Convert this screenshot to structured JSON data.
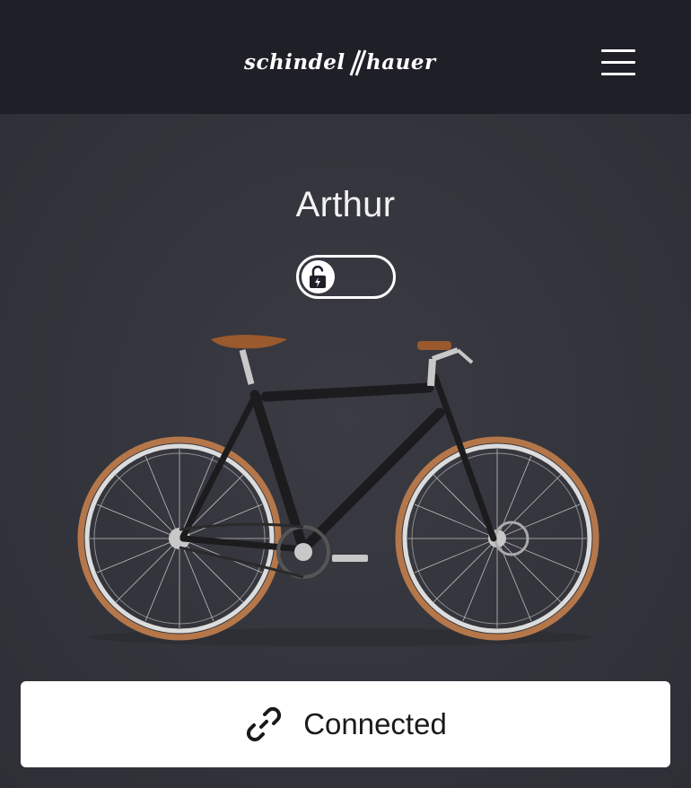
{
  "header": {
    "brand_logo": "schindelhauer",
    "menu_icon": "hamburger-menu-icon"
  },
  "bike": {
    "name": "Arthur",
    "lock": {
      "icon": "unlocked-padlock-bolt-icon"
    },
    "image": "bicycle-image"
  },
  "connection": {
    "label": "Connected",
    "icon": "link-icon"
  },
  "colors": {
    "header_bg": "#1e1f27",
    "page_bg": "#33343b",
    "text": "#ffffff",
    "button_bg": "#ffffff"
  }
}
